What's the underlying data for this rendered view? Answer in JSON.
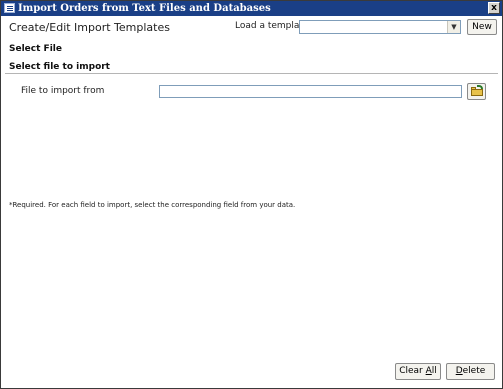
{
  "window": {
    "title": "Import Orders from Text Files and Databases",
    "close_label": "x",
    "icon": "app-window-icon"
  },
  "header": {
    "title": "Create/Edit Import Templates",
    "template_label": "Load a template",
    "template_value": "",
    "new_label": "New"
  },
  "sections": {
    "select_file": "Select File",
    "select_file_to_import": "Select file to import"
  },
  "file": {
    "label": "File to import from",
    "value": "",
    "browse_icon": "open-folder-icon"
  },
  "note": "*Required.  For each field to import, select the corresponding field from your data.",
  "footer": {
    "clear_all": {
      "pre": "Clear ",
      "mnemonic": "A",
      "post": "ll"
    },
    "delete": {
      "pre": "",
      "mnemonic": "D",
      "post": "elete"
    }
  }
}
